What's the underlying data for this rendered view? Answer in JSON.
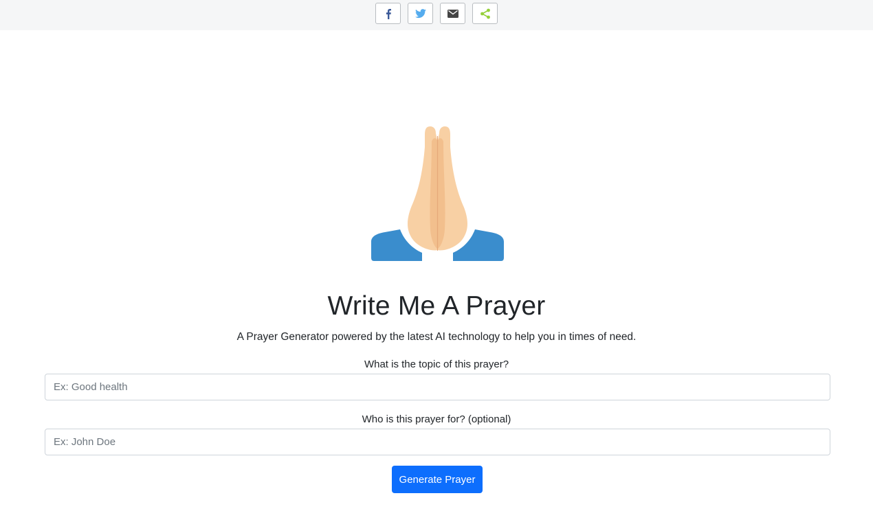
{
  "share": {
    "buttons": [
      {
        "name": "facebook",
        "icon": "facebook-icon",
        "color": "#3b5998"
      },
      {
        "name": "twitter",
        "icon": "twitter-icon",
        "color": "#55acee"
      },
      {
        "name": "email",
        "icon": "email-icon",
        "color": "#444444"
      },
      {
        "name": "sharethis",
        "icon": "share-icon",
        "color": "#95d03a"
      }
    ]
  },
  "hero": {
    "icon": "folded-hands-emoji",
    "title": "Write Me A Prayer",
    "subtitle": "A Prayer Generator powered by the latest AI technology to help you in times of need."
  },
  "form": {
    "topic_label": "What is the topic of this prayer?",
    "topic_placeholder": "Ex: Good health",
    "topic_value": "",
    "for_label": "Who is this prayer for? (optional)",
    "for_placeholder": "Ex: John Doe",
    "for_value": "",
    "submit_label": "Generate Prayer"
  },
  "colors": {
    "primary": "#0d6efd",
    "topbar_bg": "#f5f6f7",
    "sleeve": "#3a8dcd",
    "skin": "#f8d0a4"
  }
}
